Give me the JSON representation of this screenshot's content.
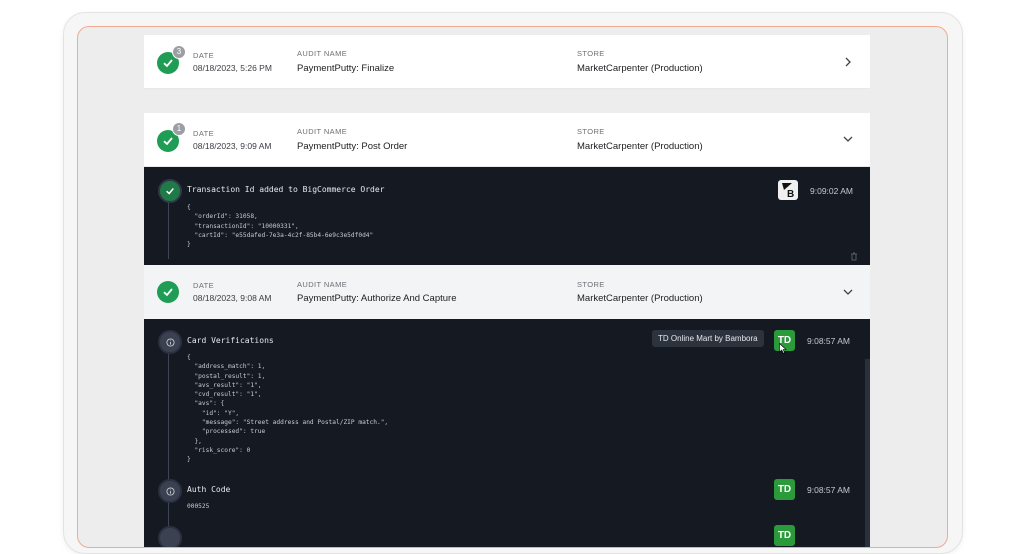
{
  "cards": [
    {
      "badge": "3",
      "date_label": "DATE",
      "date": "08/18/2023, 5:26 PM",
      "audit_label": "AUDIT NAME",
      "audit": "PaymentPutty: Finalize",
      "store_label": "STORE",
      "store": "MarketCarpenter (Production)"
    },
    {
      "badge": "1",
      "date_label": "DATE",
      "date": "08/18/2023, 9:09 AM",
      "audit_label": "AUDIT NAME",
      "audit": "PaymentPutty: Post Order",
      "store_label": "STORE",
      "store": "MarketCarpenter (Production)"
    },
    {
      "date_label": "DATE",
      "date": "08/18/2023, 9:08 AM",
      "audit_label": "AUDIT NAME",
      "audit": "PaymentPutty: Authorize And Capture",
      "store_label": "STORE",
      "store": "MarketCarpenter (Production)"
    }
  ],
  "post_order_events": [
    {
      "title": "Transaction Id added to BigCommerce Order",
      "time": "9:09:02 AM",
      "code": "{\n  \"orderId\": 31058,\n  \"transactionId\": \"10000331\",\n  \"cartId\": \"e55dafed-7e3a-4c2f-85b4-6e9c3e5df0d4\"\n}"
    }
  ],
  "authorize_events": [
    {
      "title": "Card Verifications",
      "time": "9:08:57 AM",
      "tooltip": "TD Online Mart by Bambora",
      "logo": "TD",
      "code": "{\n  \"address_match\": 1,\n  \"postal_result\": 1,\n  \"avs_result\": \"1\",\n  \"cvd_result\": \"1\",\n  \"avs\": {\n    \"id\": \"Y\",\n    \"message\": \"Street address and Postal/ZIP match.\",\n    \"processed\": true\n  },\n  \"risk_score\": 0\n}"
    },
    {
      "title": "Auth Code",
      "time": "9:08:57 AM",
      "logo": "TD",
      "code": "000525"
    },
    {
      "logo": "TD"
    }
  ]
}
